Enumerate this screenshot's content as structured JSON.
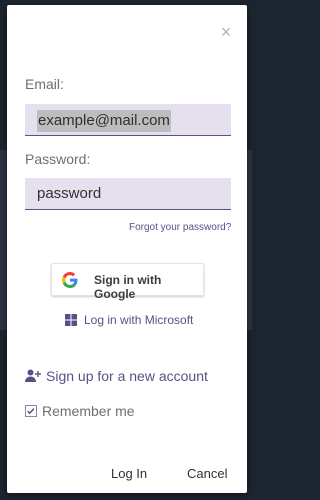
{
  "dialog": {
    "close_symbol": "×",
    "email_label": "Email:",
    "email_value": "example@mail.com",
    "password_label": "Password:",
    "password_value": "password",
    "forgot_link": "Forgot your password?",
    "google_button": "Sign in with Google",
    "microsoft_link": "Log in with Microsoft",
    "signup_link": "Sign up for a new account",
    "remember_label": "Remember me",
    "remember_checked": true,
    "login_button": "Log In",
    "cancel_button": "Cancel"
  },
  "icons": {
    "close": "close-icon",
    "google": "google-logo-icon",
    "microsoft": "microsoft-logo-icon",
    "add_user": "add-user-icon",
    "checkmark": "checkmark-icon"
  },
  "colors": {
    "accent": "#5c4f86",
    "field_background": "#e6e0ee",
    "backdrop": "#1d2530"
  }
}
